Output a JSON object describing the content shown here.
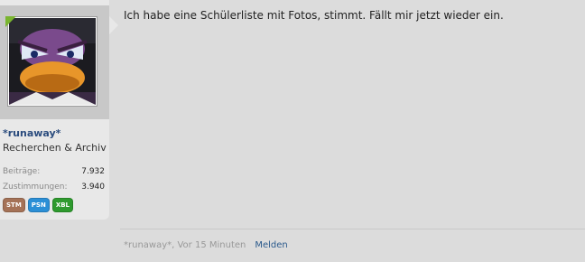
{
  "user": {
    "username": "*runaway*",
    "title": "Recherchen & Archiv",
    "stats": [
      {
        "label": "Beiträge:",
        "value": "7.932"
      },
      {
        "label": "Zustimmungen:",
        "value": "3.940"
      }
    ],
    "badges": [
      {
        "label": "STM",
        "color": "#a57257"
      },
      {
        "label": "PSN",
        "color": "#2b8fd6"
      },
      {
        "label": "XBL",
        "color": "#2e9a2e"
      }
    ]
  },
  "message": {
    "text": "Ich habe eine Schülerliste mit Fotos, stimmt. Fällt mir jetzt wieder ein."
  },
  "footer": {
    "meta": "*runaway*, Vor 15 Minuten",
    "report_label": "Melden"
  }
}
